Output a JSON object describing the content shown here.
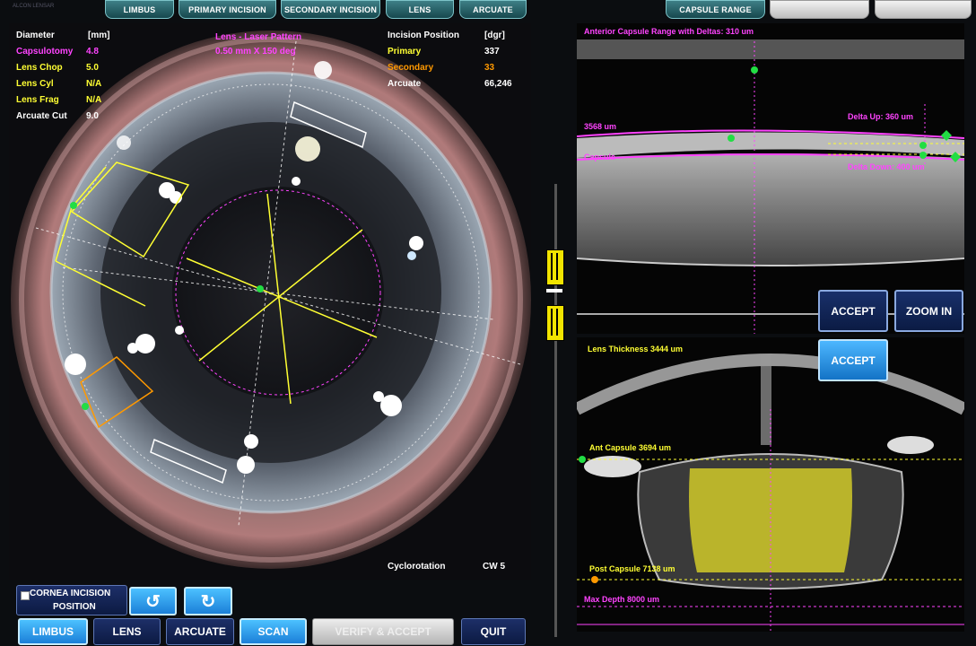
{
  "header": {
    "app_name": "ALCON LENSAR",
    "tabs_left": [
      "LIMBUS",
      "PRIMARY INCISION",
      "SECONDARY INCISION",
      "LENS",
      "ARCUATE"
    ],
    "tabs_right": [
      "CAPSULE RANGE",
      "",
      ""
    ]
  },
  "eye": {
    "diameter_header": "Diameter",
    "diameter_unit": "[mm]",
    "center_line1": "Lens - Laser Pattern",
    "center_line2": "0.50 mm X 150 deg",
    "params": [
      {
        "label": "Capsulotomy",
        "value": "4.8",
        "color": "#ff44ff"
      },
      {
        "label": "Lens Chop",
        "value": "5.0",
        "color": "#ffff33"
      },
      {
        "label": "Lens Cyl",
        "value": "N/A",
        "color": "#ffff33"
      },
      {
        "label": "Lens Frag",
        "value": "N/A",
        "color": "#ffff33"
      },
      {
        "label": "Arcuate Cut",
        "value": "9.0",
        "color": "#ffffff"
      }
    ],
    "incision_header": "Incision Position",
    "incision_unit": "[dgr]",
    "incisions": [
      {
        "label": "Primary",
        "value": "337",
        "color": "#ffff33"
      },
      {
        "label": "Secondary",
        "value": "33",
        "color": "#ff9900"
      },
      {
        "label": "Arcuate",
        "value": "66,246",
        "color": "#ffffff"
      }
    ],
    "cyclo_label": "Cyclorotation",
    "cyclo_value": "CW 5"
  },
  "oct_top": {
    "title": "Anterior Capsule Range with Deltas: 310 um",
    "label_3568": "3568 um",
    "label_delta_up": "Delta Up: 360 um",
    "label_capsule": "Capsule",
    "label_delta_down": "Delta Down: 400 um",
    "accept_label": "ACCEPT",
    "zoom_label": "ZOOM IN"
  },
  "oct_bottom": {
    "accept_label": "ACCEPT",
    "lens_thickness": "Lens Thickness 3444 um",
    "ant_capsule": "Ant Capsule 3694 um",
    "post_capsule": "Post Capsule 7138 um",
    "max_depth": "Max Depth 8000 um"
  },
  "controls": {
    "cornea_incision_line1": "CORNEA INCISION",
    "cornea_incision_line2": "POSITION",
    "rotate_ccw_icon": "rotate-ccw-icon",
    "rotate_cw_icon": "rotate-cw-icon",
    "buttons": {
      "limbus": "LIMBUS",
      "lens": "LENS",
      "arcuate": "ARCUATE",
      "scan": "SCAN",
      "verify": "VERIFY & ACCEPT",
      "quit": "QUIT"
    }
  },
  "colors": {
    "tab": "#2a6a72",
    "magenta": "#ff44ff",
    "yellow": "#ffff33",
    "orange": "#ff9900",
    "accept_blue": "#2b8fe0",
    "navy": "#14275a"
  }
}
